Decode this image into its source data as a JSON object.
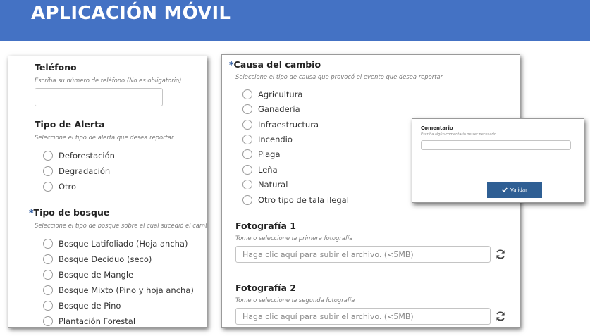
{
  "banner": {
    "title": "APLICACIÓN MÓVIL"
  },
  "left": {
    "phone": {
      "title": "Teléfono",
      "hint": "Escriba su número de teléfono (No es obligatorio)",
      "value": ""
    },
    "alert_type": {
      "title": "Tipo de Alerta",
      "hint": "Seleccione el tipo de alerta que desea reportar",
      "options": [
        "Deforestación",
        "Degradación",
        "Otro"
      ]
    },
    "forest_type": {
      "required_mark": "*",
      "title": "Tipo de bosque",
      "hint": "Seleccione el tipo de bosque sobre el cual sucedió el cambio",
      "options": [
        "Bosque Latifoliado (Hoja ancha)",
        "Bosque Decíduo (seco)",
        "Bosque de Mangle",
        "Bosque Mixto (Pino y hoja ancha)",
        "Bosque de Pino",
        "Plantación Forestal"
      ]
    }
  },
  "middle": {
    "cause": {
      "required_mark": "*",
      "title": "Causa del cambio",
      "hint": "Seleccione el tipo de causa que provocó el evento que desea reportar",
      "options": [
        "Agricultura",
        "Ganadería",
        "Infraestructura",
        "Incendio",
        "Plaga",
        "Leña",
        "Natural",
        "Otro tipo de tala ilegal"
      ]
    },
    "photo1": {
      "title": "Fotografía 1",
      "hint": "Tome o seleccione la primera fotografía",
      "placeholder": "Haga clic aquí para subir el archivo. (<5MB)"
    },
    "photo2": {
      "title": "Fotografía 2",
      "hint": "Tome o seleccione la segunda fotografía",
      "placeholder": "Haga clic aquí para subir el archivo. (<5MB)"
    }
  },
  "comment": {
    "title": "Comentario",
    "hint": "Escriba algún comentario de ser necesario",
    "value": "",
    "button_label": "Validar"
  },
  "icons": {
    "refresh": "refresh-icon",
    "check": "check-icon"
  },
  "colors": {
    "banner": "#4472c4",
    "accent": "#2d5aa0",
    "button": "#2f5f94"
  }
}
